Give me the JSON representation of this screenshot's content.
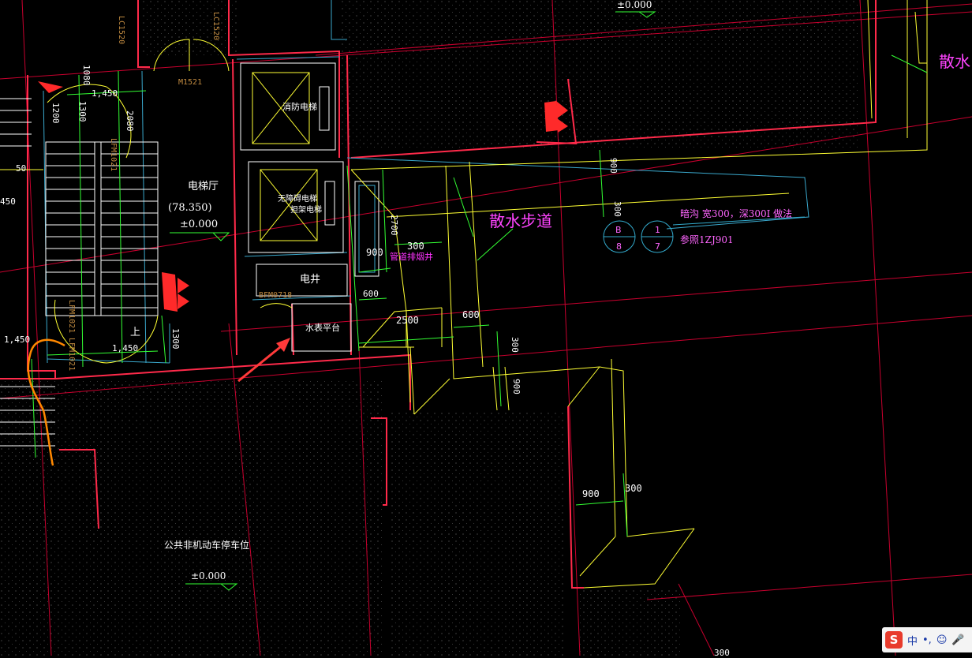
{
  "labels": {
    "elevator_hall": "电梯厅",
    "elevator_hall_level": "(78.350)",
    "elevator_hall_elev": "±0.000",
    "fire_elevator": "消防电梯",
    "accessible_elevator_line1": "无障碍电梯",
    "accessible_elevator_line2": "担架电梯",
    "elec_shaft": "电井",
    "meter_platform": "水表平台",
    "vent_shaft": "管道排烟井",
    "drain_walkway": "散水步道",
    "drain_top": "散水",
    "ditch_note": "暗沟 宽300，深300I  做法",
    "ditch_ref": "参照1ZJ901",
    "parking": "公共非机动车停车位",
    "parking_elev": "±0.000",
    "top_elev": "±0.000",
    "stair_up": "上"
  },
  "tags": {
    "m1521": "M1521",
    "fm1021_a": "LFM1021",
    "fm1021_b": "LFM1021",
    "fm1021_c": "LFM1021",
    "bfm": "BFM0718",
    "lc_left": "LC1520",
    "lc_top": "LC1520"
  },
  "dims": {
    "d1450a": "1,450",
    "d1450b": "1,450",
    "d1450c": "1,450",
    "d1300": "1300",
    "d2080": "2080",
    "d1300b": "1300",
    "d1200": "1200",
    "d1080": "1080",
    "d900a": "900",
    "d300a": "300",
    "d2700": "2700",
    "d300b": "300",
    "d900b": "900",
    "d600a": "600",
    "d2500": "2500",
    "d600b": "600",
    "d300c": "300",
    "d900c": "900",
    "d900d": "900",
    "d300d": "300",
    "d50": "50",
    "d300e": "300",
    "d450": "450"
  },
  "detail_symbol": {
    "a_top": "B",
    "a_bottom": "8",
    "b_top": "1",
    "b_bottom": "7"
  },
  "taskbar": {
    "ime_logo": "S",
    "ime_lang": "中",
    "ime_punct": "•,"
  },
  "colors": {
    "background": "#000000",
    "wall": "#ff2244",
    "axis": "#cc0033",
    "yellow": "#ffff33",
    "green": "#33ff33",
    "cyan": "#33aacc",
    "magenta": "#ff33ff",
    "white": "#ffffff",
    "orange": "#ff8800"
  }
}
